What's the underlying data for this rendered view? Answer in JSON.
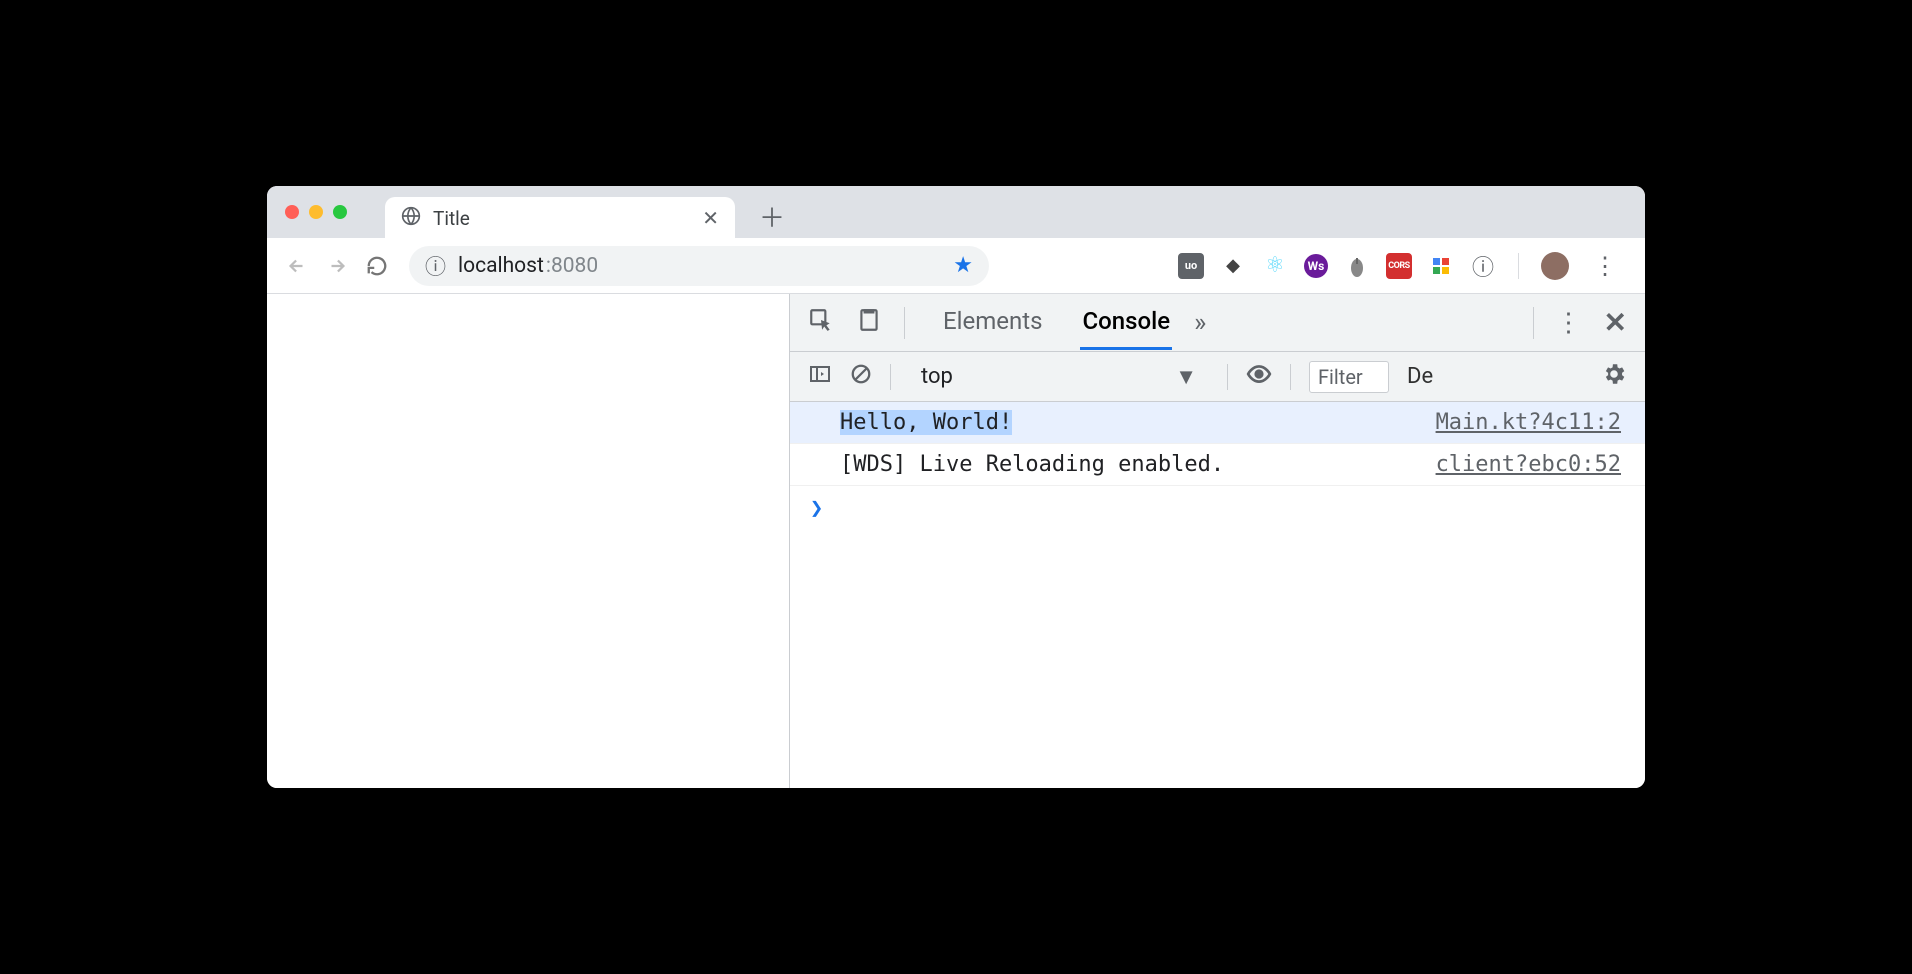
{
  "tab": {
    "title": "Title"
  },
  "omnibox": {
    "host": "localhost",
    "port": ":8080"
  },
  "extensions": [
    {
      "name": "ublock",
      "label": "uo"
    },
    {
      "name": "devtool-1",
      "label": "◆"
    },
    {
      "name": "react-devtools",
      "label": "⚛"
    },
    {
      "name": "webstorm",
      "label": "Ws"
    },
    {
      "name": "mouse-ext",
      "label": "🖱"
    },
    {
      "name": "cors",
      "label": "CORS"
    },
    {
      "name": "lighthouse",
      "label": "◧"
    },
    {
      "name": "info",
      "label": "ⓘ"
    }
  ],
  "devtools": {
    "tabs": {
      "elements": "Elements",
      "console": "Console"
    },
    "console_toolbar": {
      "context": "top",
      "filter_placeholder": "Filter",
      "levels_truncated": "De"
    },
    "logs": [
      {
        "message": "Hello, World!",
        "source": "Main.kt?4c11:2",
        "highlight": true,
        "selected": true
      },
      {
        "message": "[WDS] Live Reloading enabled.",
        "source": "client?ebc0:52",
        "highlight": false,
        "selected": false
      }
    ],
    "prompt": ">"
  }
}
